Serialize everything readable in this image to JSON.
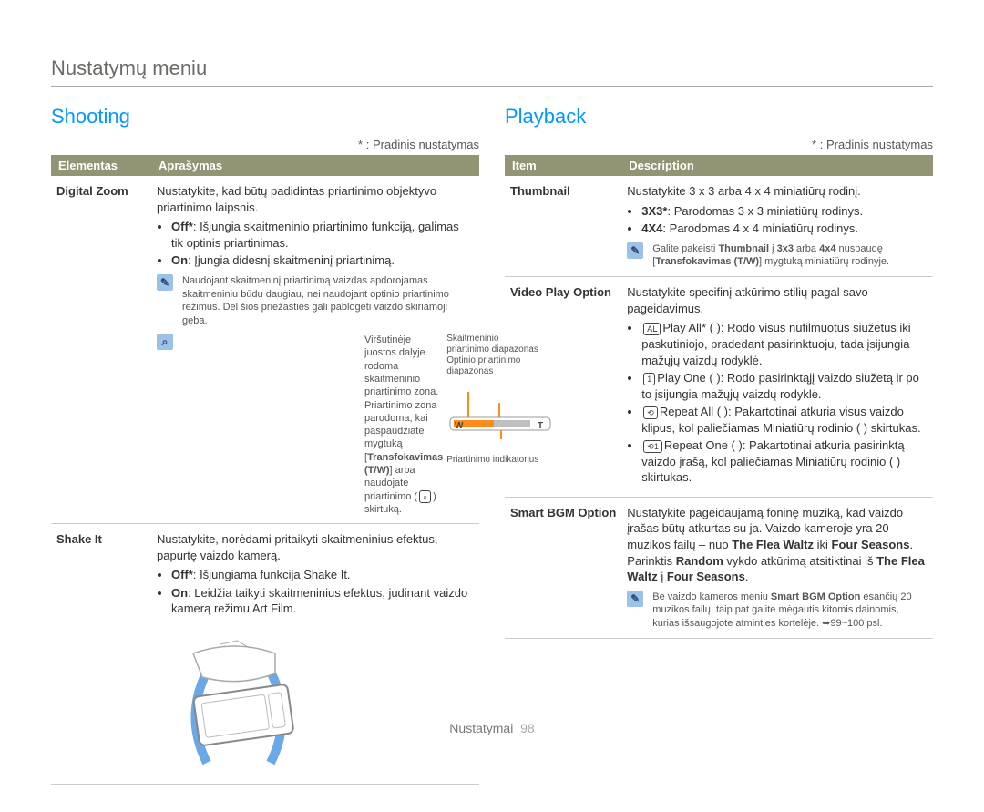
{
  "breadcrumb": "Nustatymų meniu",
  "footer": {
    "label": "Nustatymai",
    "page": "98"
  },
  "columns": {
    "left": {
      "title": "Shooting",
      "default_note": "* : Pradinis nustatymas",
      "head_item": "Elementas",
      "head_desc": "Aprašymas",
      "rows": {
        "digital_zoom": {
          "item": "Digital Zoom",
          "intro": "Nustatykite, kad būtų padidintas priartinimo objektyvo priartinimo laipsnis.",
          "off_label": "Off*",
          "off_text": ": Išjungia skaitmeninio priartinimo funkciją, galimas tik optinis priartinimas.",
          "on_label": "On",
          "on_text": ": Įjungia didesnį skaitmeninį priartinimą.",
          "note1": "Naudojant skaitmeninį priartinimą vaizdas apdorojamas skaitmeniniu būdu daugiau, nei naudojant optinio priartinimo režimus. Dėl šios priežasties gali pablogėti vaizdo skiriamoji geba.",
          "zoom_box": {
            "l1": "Viršutinėje juostos dalyje",
            "l2": "rodoma skaitmeninio priartinimo",
            "l3": "zona. Priartinimo zona",
            "l4": "parodoma, kai paspaudžiate",
            "l5a": "mygtuką [",
            "l5b": "Transfokavimas",
            "l5c": "(T/W)",
            "l5d": "] arba naudojate",
            "l6": "priartinimo (",
            "l7": ") skirtuką.",
            "r1": "Skaitmeninio",
            "r2": "priartinimo diapazonas",
            "r3": "Optinio priartinimo",
            "r4": "diapazonas",
            "r5": "Priartinimo indikatorius"
          }
        },
        "shake_it": {
          "item": "Shake It",
          "intro": "Nustatykite, norėdami pritaikyti skaitmeninius efektus, papurtę vaizdo kamerą.",
          "off_label": "Off*",
          "off_text": ": Išjungiama funkcija Shake It.",
          "on_label": "On",
          "on_text": ": Leidžia taikyti skaitmeninius efektus, judinant vaizdo kamerą režimu Art Film."
        }
      }
    },
    "right": {
      "title": "Playback",
      "default_note": "* : Pradinis nustatymas",
      "head_item": "Item",
      "head_desc": "Description",
      "rows": {
        "thumbnail": {
          "item": "Thumbnail",
          "intro": "Nustatykite 3 x 3 arba 4 x 4 miniatiūrų rodinį.",
          "b1a": "3X3*",
          "b1b": ": Parodomas 3 x 3 miniatiūrų rodinys.",
          "b2a": "4X4",
          "b2b": ": Parodomas 4 x 4 miniatiūrų rodinys.",
          "note_a": "Galite pakeisti ",
          "note_b": "Thumbnail",
          "note_c": " į ",
          "note_d": "3x3",
          "note_e": " arba ",
          "note_f": "4x4",
          "note_g": " nuspaudę [",
          "note_h": "Transfokavimas (T/W)",
          "note_i": "] mygtuką miniatiūrų rodinyje."
        },
        "video_play": {
          "item": "Video Play Option",
          "intro": "Nustatykite specifinį atkūrimo stilių pagal savo pageidavimus.",
          "b1": "Play All* (  ): Rodo visus nufilmuotus siužetus iki paskutiniojo, pradedant pasirinktuoju, tada įsijungia mažųjų vaizdų rodyklė.",
          "b2": "Play One (  ): Rodo pasirinktąjį vaizdo siužetą ir po to įsijungia mažųjų vaizdų rodyklė.",
          "b3": "Repeat All (  ): Pakartotinai atkuria visus vaizdo klipus, kol paliečiamas Miniatiūrų rodinio (  ) skirtukas.",
          "b4": "Repeat One (  ): Pakartotinai atkuria pasirinktą vaizdo įrašą, kol paliečiamas Miniatiūrų rodinio (  ) skirtukas."
        },
        "smart_bgm": {
          "item": "Smart BGM Option",
          "intro_a": "Nustatykite pageidaujamą foninę muziką, kad vaizdo įrašas būtų atkurtas su ja. Vaizdo kameroje yra 20 muzikos failų – nuo ",
          "intro_b": "The Flea Waltz",
          "intro_c": " iki ",
          "intro_d": "Four Seasons",
          "intro_e": ". Parinktis ",
          "intro_f": "Random",
          "intro_g": " vykdo atkūrimą atsitiktinai iš ",
          "intro_h": "The Flea Waltz",
          "intro_i": " į ",
          "intro_j": "Four Seasons",
          "intro_k": ".",
          "note_a": "Be vaizdo kameros meniu ",
          "note_b": "Smart BGM Option",
          "note_c": " esančių 20 muzikos failų, taip pat galite mėgautis kitomis dainomis, kurias išsaugojote atminties kortelėje. ➥99~100 psl."
        }
      }
    }
  }
}
